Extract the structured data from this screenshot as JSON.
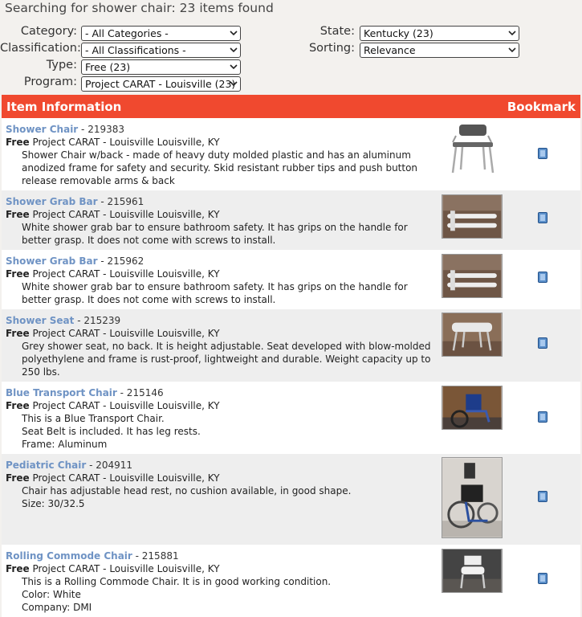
{
  "header": {
    "title": "Searching for shower chair: 23 items found"
  },
  "filters": {
    "category": {
      "label": "Category:",
      "value": "- All Categories -"
    },
    "classification": {
      "label": "Classification:",
      "value": "- All Classifications -"
    },
    "type": {
      "label": "Type:",
      "value": "Free (23)"
    },
    "program": {
      "label": "Program:",
      "value": "Project CARAT - Louisville (23)"
    },
    "state": {
      "label": "State:",
      "value": "Kentucky (23)"
    },
    "sorting": {
      "label": "Sorting:",
      "value": "Relevance"
    }
  },
  "table": {
    "col_item": "Item Information",
    "col_bookmark": "Bookmark",
    "rows": [
      {
        "title": "Shower Chair",
        "id": " - 219383",
        "type": "Free",
        "program": " Project CARAT - Louisville Louisville, KY",
        "desc": [
          "Shower Chair w/back - made of heavy duty molded plastic and has an aluminum anodized frame for safety and security. Skid resistant rubber tips and push button release removable arms & back"
        ],
        "image": "shower-chair"
      },
      {
        "title": "Shower Grab Bar",
        "id": " - 215961",
        "type": "Free",
        "program": " Project CARAT - Louisville Louisville, KY",
        "desc": [
          "White shower grab bar to ensure bathroom safety. It has grips on the handle for better grasp. It does not come with screws to install."
        ],
        "image": "grab-bar"
      },
      {
        "title": "Shower Grab Bar",
        "id": " - 215962",
        "type": "Free",
        "program": " Project CARAT - Louisville Louisville, KY",
        "desc": [
          "White shower grab bar to ensure bathroom safety. It has grips on the handle for better grasp. It does not come with screws to install."
        ],
        "image": "grab-bar"
      },
      {
        "title": "Shower Seat",
        "id": " - 215239",
        "type": "Free",
        "program": " Project CARAT - Louisville Louisville, KY",
        "desc": [
          "Grey shower seat, no back. It is height adjustable. Seat developed with blow-molded polyethylene and frame is rust-proof, lightweight and durable. Weight capacity up to 250 lbs."
        ],
        "image": "shower-seat"
      },
      {
        "title": "Blue Transport Chair",
        "id": " - 215146",
        "type": "Free",
        "program": " Project CARAT - Louisville Louisville, KY",
        "desc": [
          "This is a Blue Transport Chair.",
          "Seat Belt is included. It has leg rests.",
          "Frame: Aluminum"
        ],
        "image": "transport-chair"
      },
      {
        "title": "Pediatric Chair",
        "id": " - 204911",
        "type": "Free",
        "program": " Project CARAT - Louisville Louisville, KY",
        "desc": [
          "Chair has adjustable head rest, no cushion available, in good shape.",
          "Size: 30/32.5"
        ],
        "image": "pediatric-chair"
      },
      {
        "title": "Rolling Commode Chair",
        "id": " - 215881",
        "type": "Free",
        "program": " Project CARAT - Louisville Louisville, KY",
        "desc": [
          "This is a Rolling Commode Chair. It is in good working condition.",
          "Color: White",
          "Company: DMI"
        ],
        "image": "commode-chair"
      }
    ]
  },
  "colors": {
    "header_bar": "#f0492f",
    "link": "#6f93c4",
    "row_alt": "#eeeeee"
  }
}
